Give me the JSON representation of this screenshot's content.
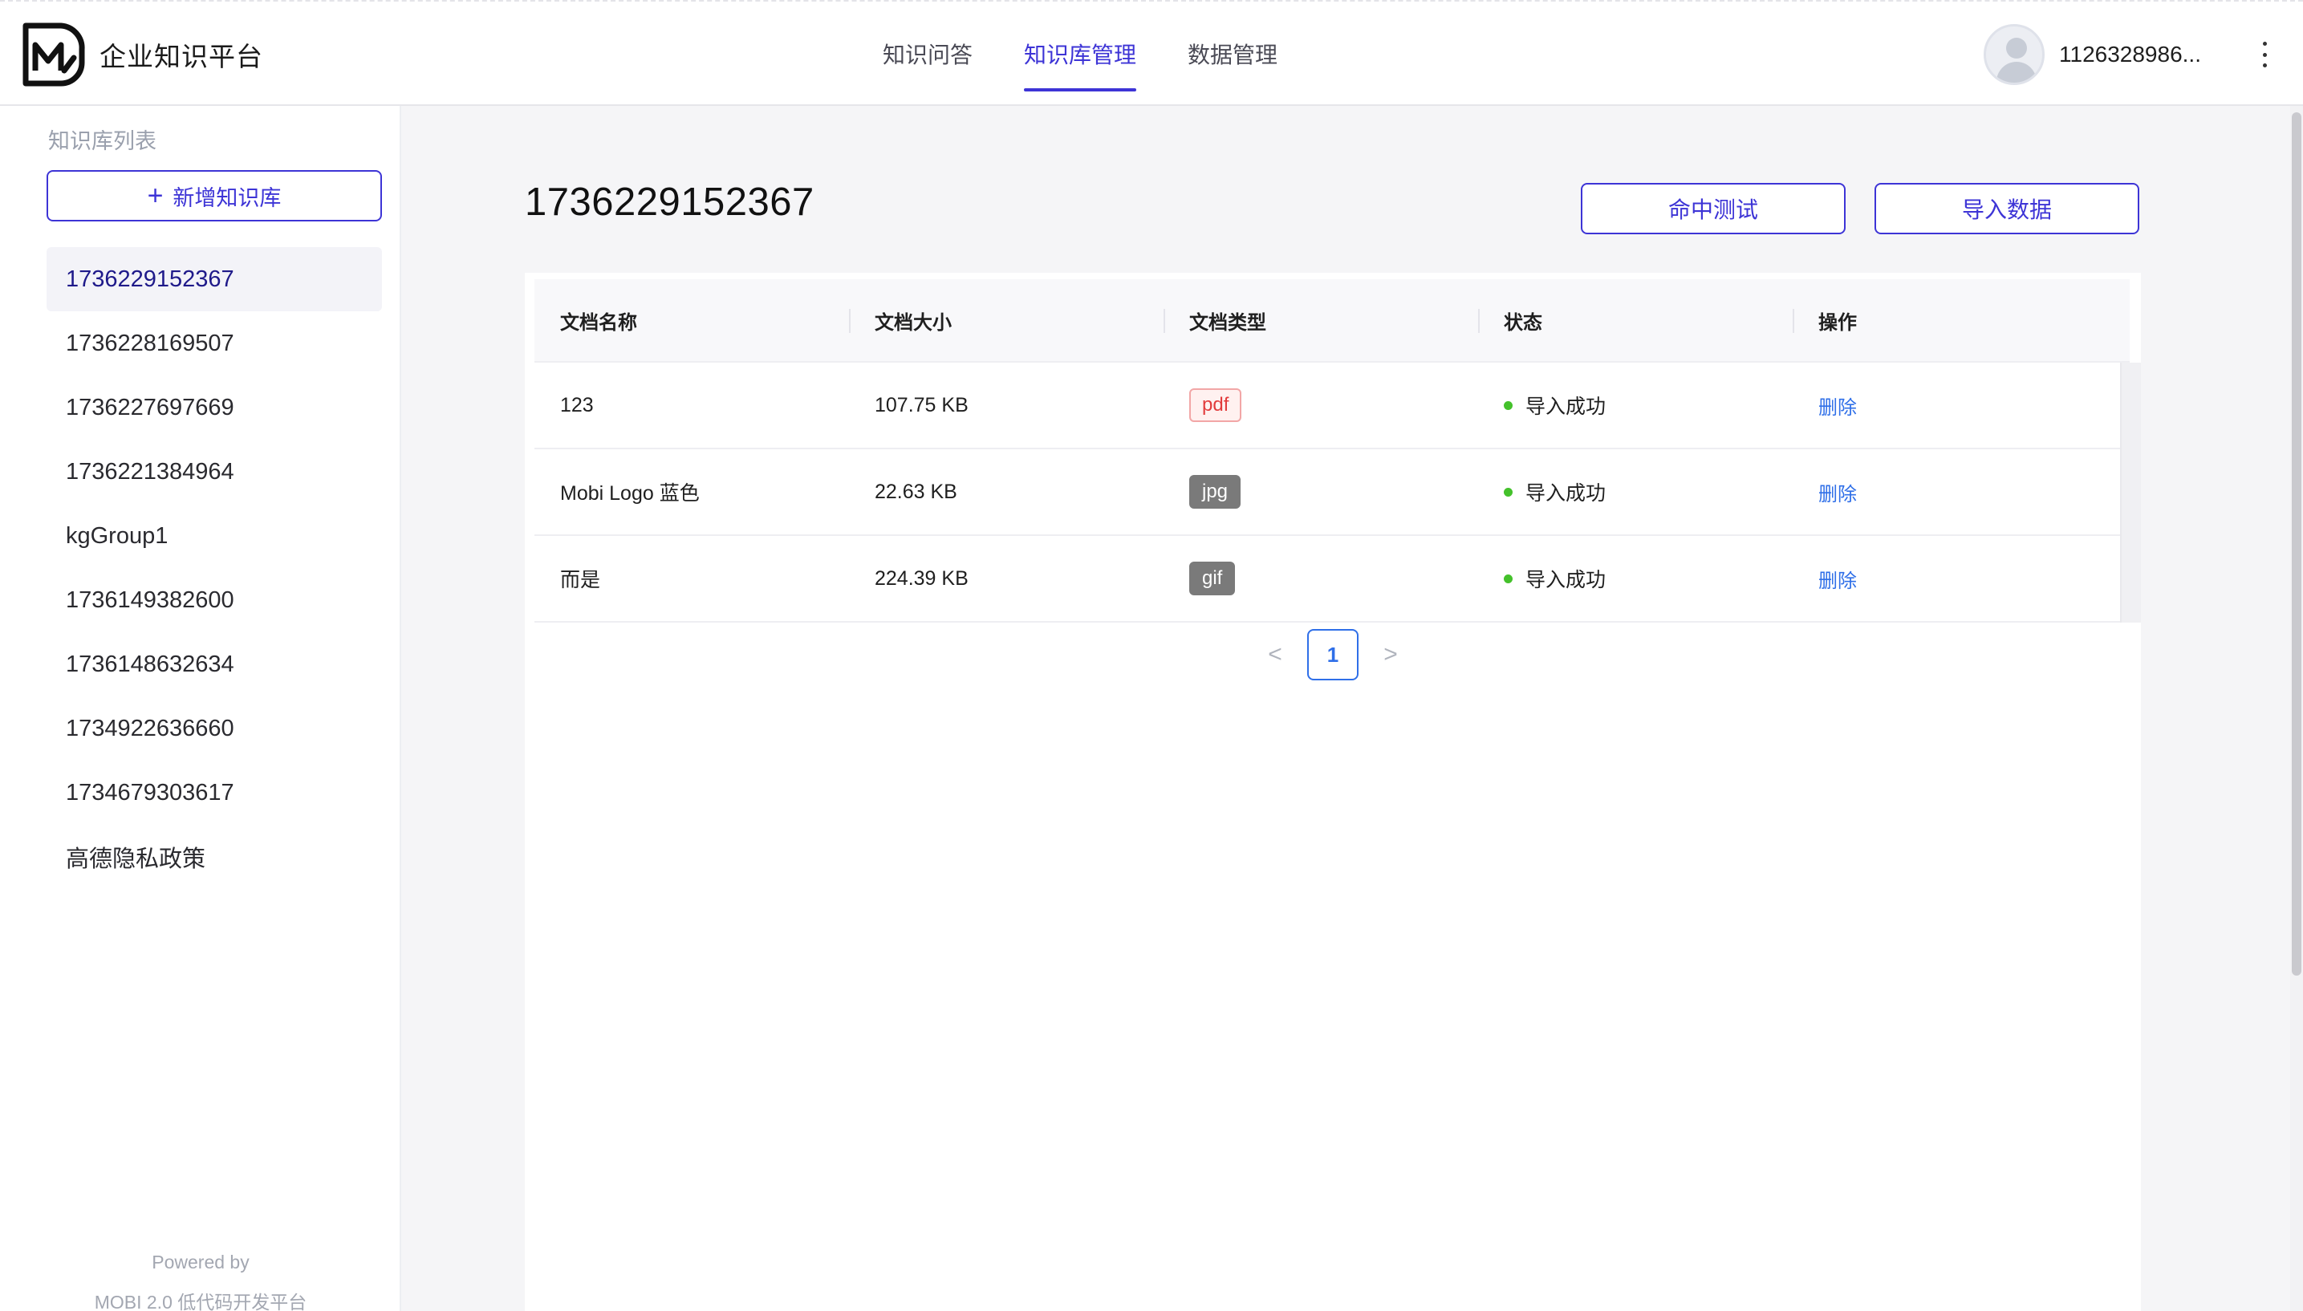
{
  "header": {
    "brand_name": "企业知识平台",
    "nav": [
      {
        "label": "知识问答",
        "active": false
      },
      {
        "label": "知识库管理",
        "active": true
      },
      {
        "label": "数据管理",
        "active": false
      }
    ],
    "username": "1126328986...",
    "accent_color": "#3d34d6"
  },
  "sidebar": {
    "title": "知识库列表",
    "add_button_label": "新增知识库",
    "items": [
      {
        "label": "1736229152367",
        "selected": true
      },
      {
        "label": "1736228169507"
      },
      {
        "label": "1736227697669"
      },
      {
        "label": "1736221384964"
      },
      {
        "label": "kgGroup1"
      },
      {
        "label": "1736149382600"
      },
      {
        "label": "1736148632634"
      },
      {
        "label": "1734922636660"
      },
      {
        "label": "1734679303617"
      },
      {
        "label": "高德隐私政策"
      }
    ],
    "footer_line1": "Powered by",
    "footer_line2": "MOBI 2.0 低代码开发平台"
  },
  "main": {
    "title": "1736229152367",
    "hit_test_button": "命中测试",
    "import_button": "导入数据",
    "table": {
      "columns": [
        "文档名称",
        "文档大小",
        "文档类型",
        "状态",
        "操作"
      ],
      "rows": [
        {
          "name": "123",
          "size": "107.75 KB",
          "type": "pdf",
          "status": "导入成功",
          "action": "删除"
        },
        {
          "name": "Mobi Logo 蓝色",
          "size": "22.63 KB",
          "type": "jpg",
          "status": "导入成功",
          "action": "删除"
        },
        {
          "name": "而是",
          "size": "224.39 KB",
          "type": "gif",
          "status": "导入成功",
          "action": "删除"
        }
      ]
    },
    "pagination": {
      "prev": "<",
      "current": "1",
      "next": ">"
    },
    "status_color": "#44c12b",
    "link_color": "#2f6fe8"
  }
}
